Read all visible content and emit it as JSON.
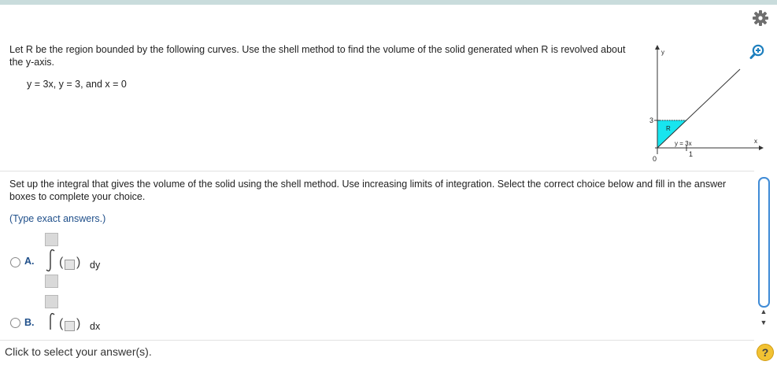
{
  "header": {
    "settings_icon": "gear-icon",
    "zoom_icon": "zoom-in-icon"
  },
  "problem": {
    "text": "Let R be the region bounded by the following curves. Use the shell method to find the volume of the solid generated when R is revolved about the y-axis.",
    "equation": "y = 3x, y = 3, and x = 0"
  },
  "graph": {
    "y_axis_label": "y",
    "x_axis_label": "x",
    "tick_y": "3",
    "origin_label": "0",
    "tick_x": "1",
    "region_label": "R",
    "curve_label": "y = 3x",
    "region_color": "#18e5ef"
  },
  "question": {
    "instructions": "Set up the integral that gives the volume of the solid using the shell method. Use increasing limits of integration. Select the correct choice below and fill in the answer boxes to complete your choice.",
    "hint": "(Type exact answers.)"
  },
  "options": [
    {
      "label": "A.",
      "differential": "dy"
    },
    {
      "label": "B.",
      "differential": "dx"
    }
  ],
  "footer": {
    "status": "Click to select your answer(s).",
    "help_label": "?"
  }
}
